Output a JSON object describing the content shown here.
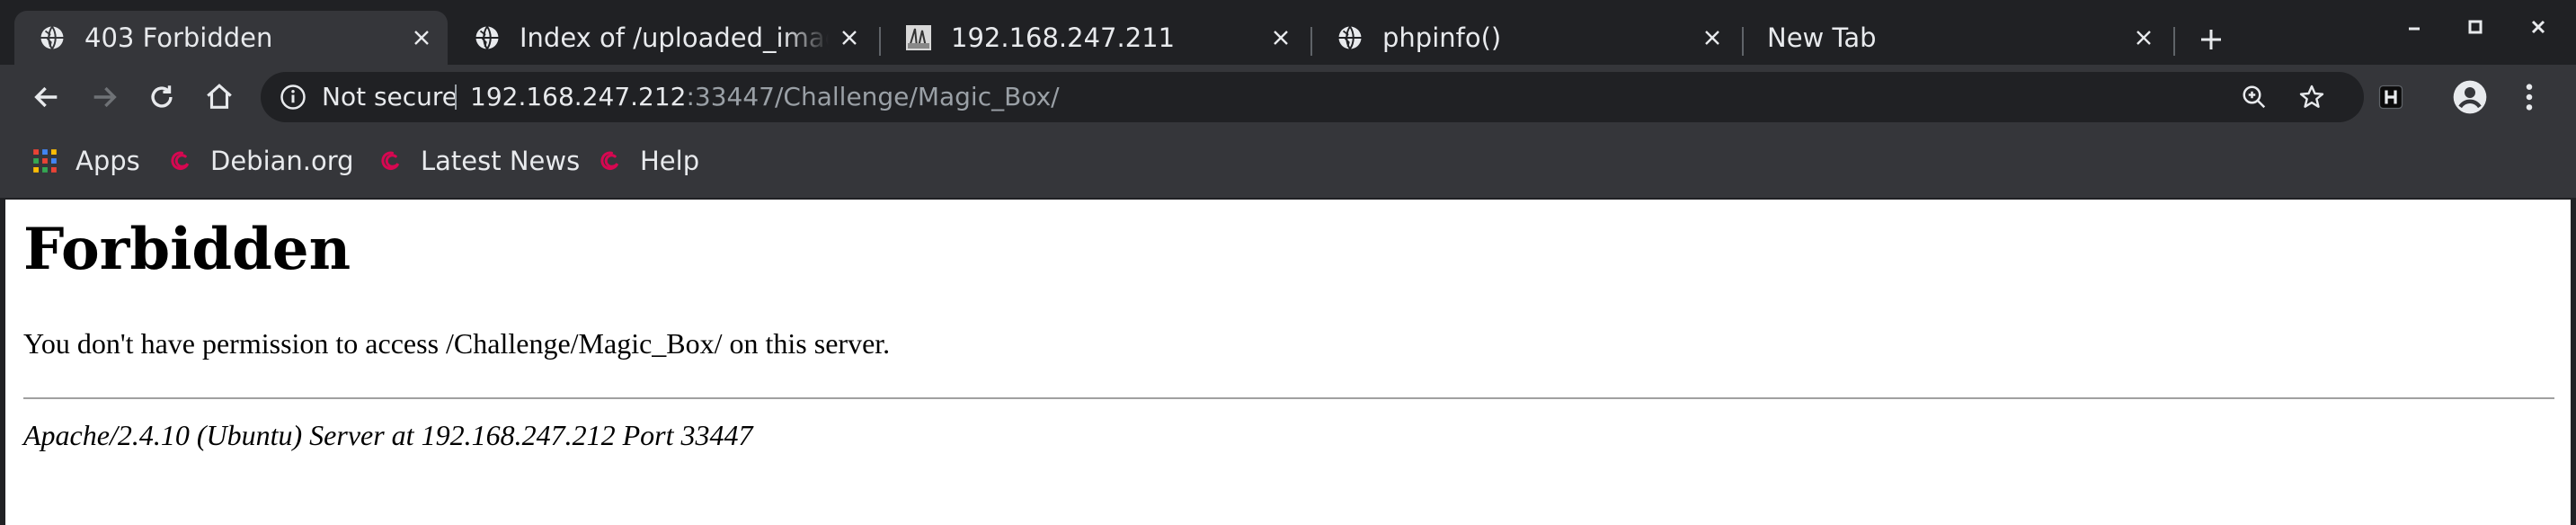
{
  "tabs": [
    {
      "title": "403 Forbidden",
      "icon": "globe-icon",
      "active": true
    },
    {
      "title": "Index of /uploaded_image",
      "icon": "globe-icon",
      "active": false
    },
    {
      "title": "192.168.247.211",
      "icon": "site-logo-icon",
      "active": false
    },
    {
      "title": "phpinfo()",
      "icon": "globe-icon",
      "active": false
    },
    {
      "title": "New Tab",
      "icon": "",
      "active": false
    }
  ],
  "omnibox": {
    "security_label": "Not secure",
    "url_host": "192.168.247.212",
    "url_rest": ":33447/Challenge/Magic_Box/"
  },
  "bookmarks": [
    {
      "label": "Apps",
      "icon": "apps-grid-icon"
    },
    {
      "label": "Debian.org",
      "icon": "debian-swirl-icon"
    },
    {
      "label": "Latest News",
      "icon": "debian-swirl-icon"
    },
    {
      "label": "Help",
      "icon": "debian-swirl-icon"
    }
  ],
  "page": {
    "heading": "Forbidden",
    "message": "You don't have permission to access /Challenge/Magic_Box/ on this server.",
    "signature": "Apache/2.4.10 (Ubuntu) Server at 192.168.247.212 Port 33447"
  },
  "colors": {
    "chrome_dark": "#202124",
    "chrome_mid": "#35363a",
    "chrome_text": "#e8eaed",
    "url_dim": "#9aa0a6",
    "debian_red": "#d70751"
  }
}
